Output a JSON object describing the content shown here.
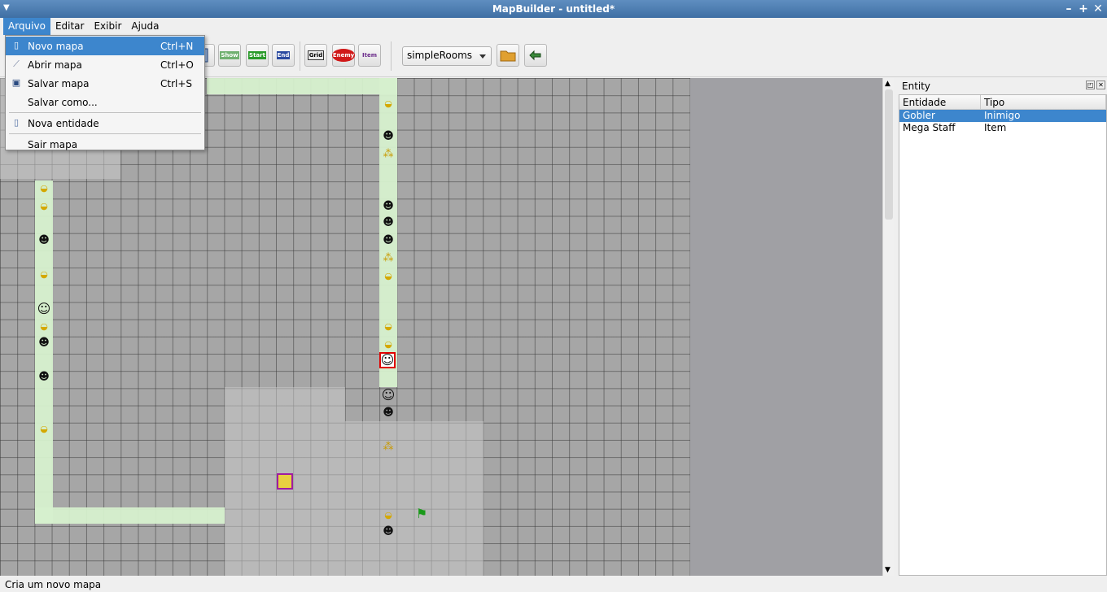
{
  "window": {
    "title": "MapBuilder - untitled*"
  },
  "menubar": {
    "items": [
      {
        "label": "Arquivo",
        "active": true
      },
      {
        "label": "Editar"
      },
      {
        "label": "Exibir"
      },
      {
        "label": "Ajuda"
      }
    ]
  },
  "file_menu": {
    "items": [
      {
        "label": "Novo mapa",
        "shortcut": "Ctrl+N",
        "icon": "new-file-icon",
        "highlighted": true
      },
      {
        "label": "Abrir mapa",
        "shortcut": "Ctrl+O",
        "icon": "open-icon"
      },
      {
        "label": "Salvar mapa",
        "shortcut": "Ctrl+S",
        "icon": "save-icon"
      },
      {
        "label": "Salvar como...",
        "shortcut": ""
      },
      {
        "label": "Nova entidade",
        "shortcut": "",
        "icon": "new-entity-icon"
      },
      {
        "label": "Sair mapa",
        "shortcut": ""
      }
    ]
  },
  "toolbar": {
    "buttons": [
      {
        "label": "Show",
        "icon": "show-icon"
      },
      {
        "label": "Start",
        "icon": "start-flag-icon"
      },
      {
        "label": "End",
        "icon": "end-flag-icon"
      },
      {
        "label": "Grid",
        "icon": "grid-icon"
      },
      {
        "label": "Enemy",
        "icon": "enemy-icon"
      },
      {
        "label": "Item",
        "icon": "item-icon"
      }
    ],
    "room_type": "simpleRooms",
    "open_icon": "folder-icon",
    "apply_icon": "apply-arrow-icon"
  },
  "entity_panel": {
    "title": "Entity",
    "columns": [
      "Entidade",
      "Tipo"
    ],
    "rows": [
      {
        "name": "Gobler",
        "type": "Inimigo",
        "selected": true
      },
      {
        "name": "Mega Staff",
        "type": "Item",
        "selected": false
      }
    ]
  },
  "status": {
    "text": "Cria um novo mapa"
  }
}
